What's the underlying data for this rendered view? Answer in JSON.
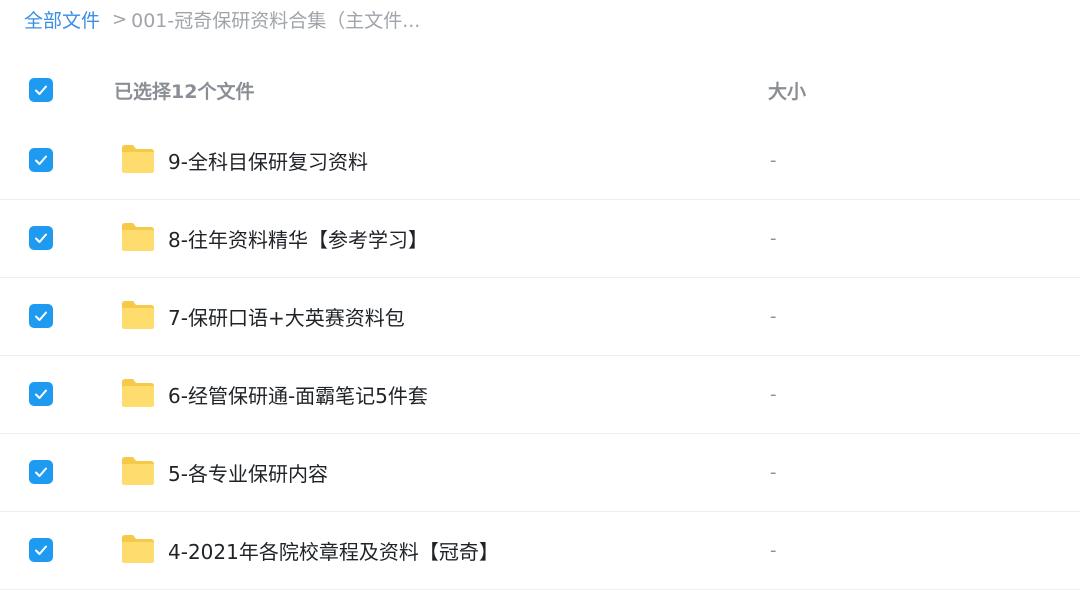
{
  "breadcrumb": {
    "root": "全部文件",
    "separator": ">",
    "current": "001-冠奇保研资料合集（主文件..."
  },
  "header": {
    "selection_label": "已选择12个文件",
    "size_label": "大小"
  },
  "colors": {
    "checkbox": "#1e9bf0",
    "link": "#3a8ee6",
    "folder_back": "#f7c948",
    "folder_front": "#ffdc6e"
  },
  "icons": {
    "checkbox": "check-icon",
    "folder": "folder-icon"
  },
  "files": [
    {
      "name": "9-全科目保研复习资料",
      "size": "-",
      "checked": true
    },
    {
      "name": "8-往年资料精华【参考学习】",
      "size": "-",
      "checked": true
    },
    {
      "name": "7-保研口语+大英赛资料包",
      "size": "-",
      "checked": true
    },
    {
      "name": "6-经管保研通-面霸笔记5件套",
      "size": "-",
      "checked": true
    },
    {
      "name": "5-各专业保研内容",
      "size": "-",
      "checked": true
    },
    {
      "name": "4-2021年各院校章程及资料【冠奇】",
      "size": "-",
      "checked": true
    }
  ]
}
